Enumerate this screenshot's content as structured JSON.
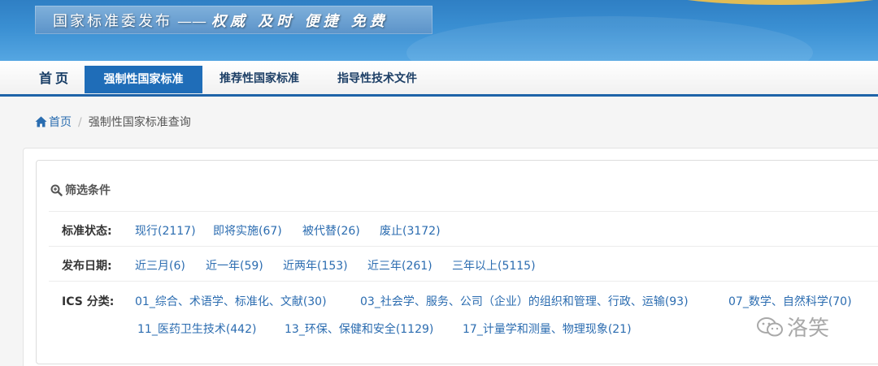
{
  "banner": {
    "slogan_main": "国家标准委发布",
    "slogan_dash": "——",
    "slogan_tags": "权威 及时 便捷 免费"
  },
  "nav": {
    "home": "首页",
    "mandatory": "强制性国家标准",
    "recommended": "推荐性国家标准",
    "guidance": "指导性技术文件",
    "active": "强制性国家标准"
  },
  "breadcrumb": {
    "home": "首页",
    "separator": "/",
    "current": "强制性国家标准查询"
  },
  "filters": {
    "title": "筛选条件",
    "status": {
      "label": "标准状态:",
      "options": [
        "现行(2117)",
        "即将实施(67)",
        "被代替(26)",
        "废止(3172)"
      ]
    },
    "date": {
      "label": "发布日期:",
      "options": [
        "近三月(6)",
        "近一年(59)",
        "近两年(153)",
        "近三年(261)",
        "三年以上(5115)"
      ]
    },
    "ics": {
      "label": "ICS 分类:",
      "options": [
        "01_综合、术语学、标准化、文献(30)",
        "03_社会学、服务、公司（企业）的组织和管理、行政、运输(93)",
        "07_数学、自然科学(70)",
        "11_医药卫生技术(442)",
        "13_环保、保健和安全(1129)",
        "17_计量学和测量、物理现象(21)"
      ]
    }
  },
  "watermark": {
    "text": "洛笑"
  },
  "colors": {
    "link": "#2b6cb0",
    "nav_active_bg": "#1f6db8",
    "nav_border": "#1e63a8",
    "banner": "#3a8fd2"
  }
}
